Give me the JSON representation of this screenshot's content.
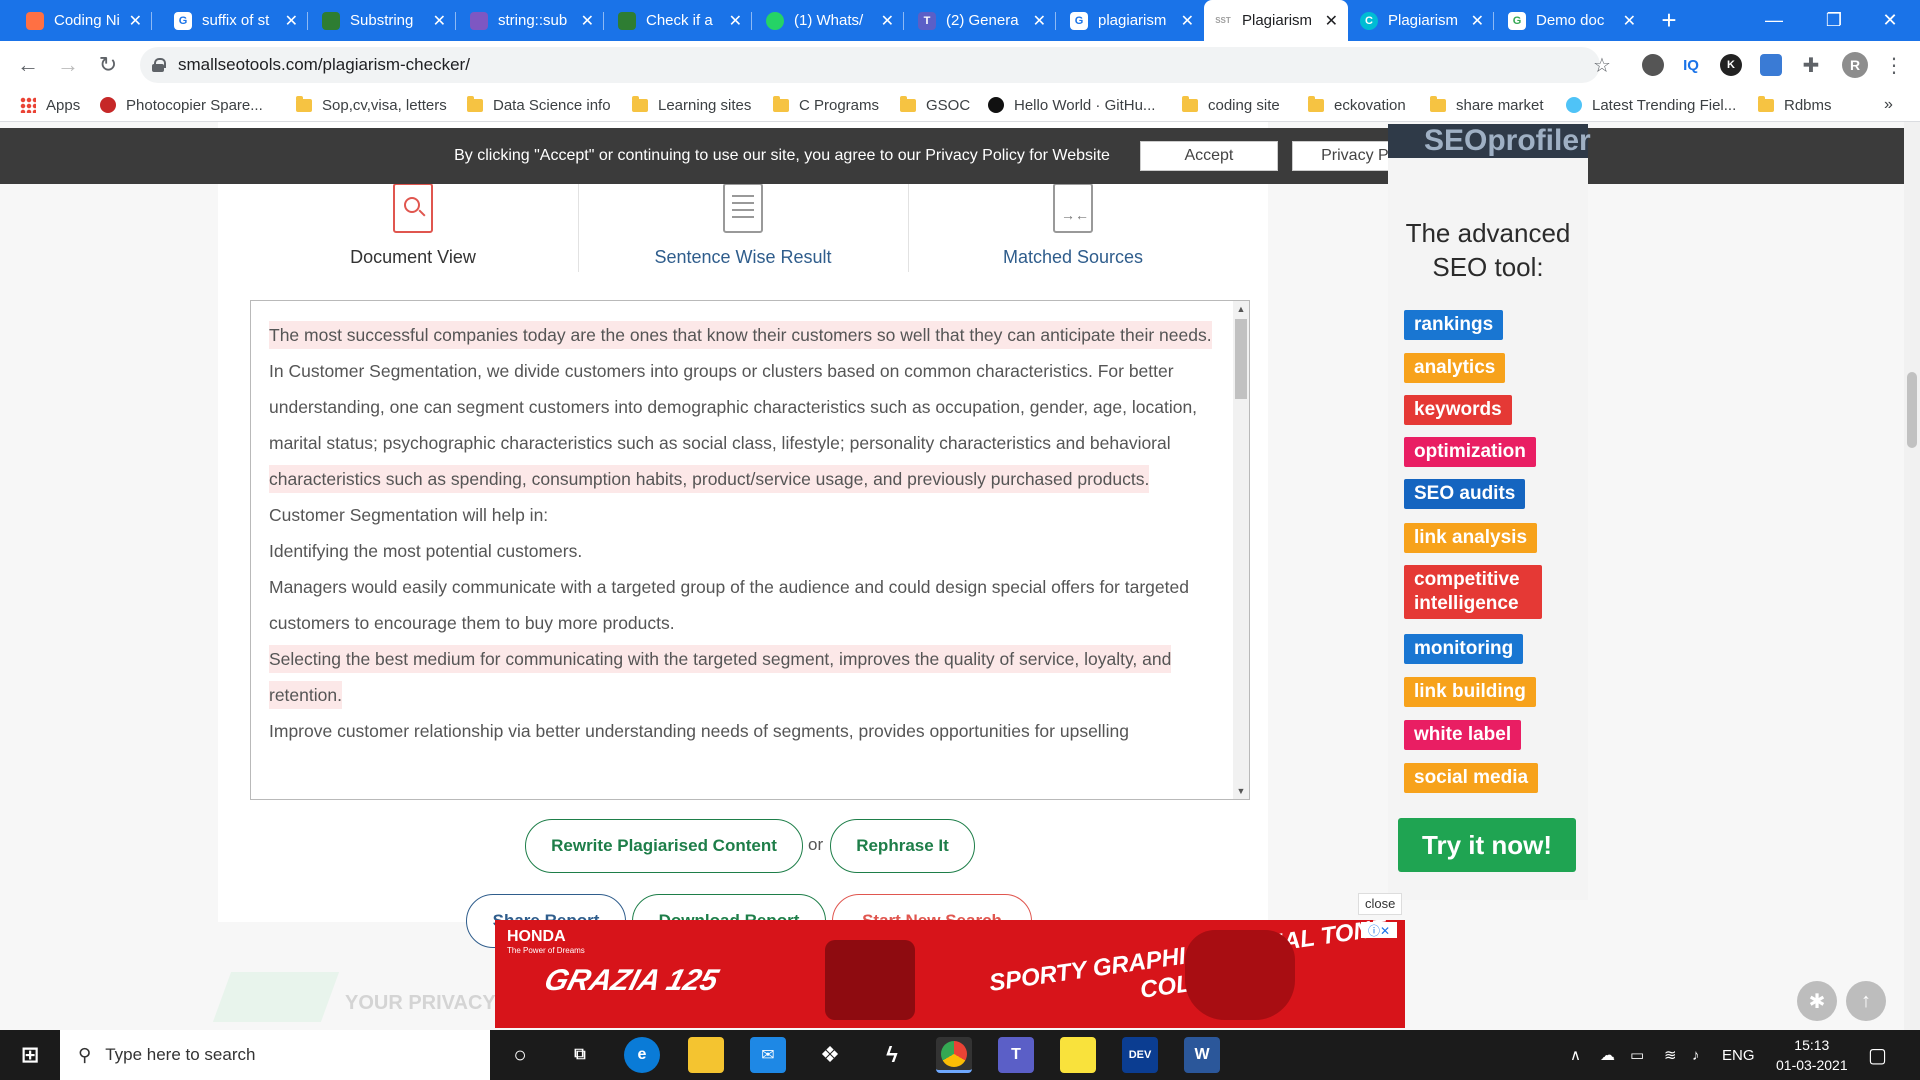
{
  "browser": {
    "tabs": [
      {
        "title": "Coding Ni",
        "color": "#ff7043",
        "active": false
      },
      {
        "title": "suffix of st",
        "color": "#ffffff",
        "active": false
      },
      {
        "title": "Substring",
        "color": "#2e7d32",
        "active": false
      },
      {
        "title": "string::sub",
        "color": "#7e57c2",
        "active": false
      },
      {
        "title": "Check if a",
        "color": "#2e7d32",
        "active": false
      },
      {
        "title": "(1) Whats/",
        "color": "#25d366",
        "active": false
      },
      {
        "title": "(2) Genera",
        "color": "#5b5fc7",
        "active": false
      },
      {
        "title": "plagiarism",
        "color": "#ffffff",
        "active": false
      },
      {
        "title": "Plagiarism",
        "color": "#9e9e9e",
        "active": true
      },
      {
        "title": "Plagiarism",
        "color": "#00bcd4",
        "active": false
      },
      {
        "title": "Demo doc",
        "color": "#34a853",
        "active": false
      }
    ],
    "new_tab": "+",
    "url": "smallseotools.com/plagiarism-checker/",
    "profile_initial": "R",
    "ext_iq": "IQ",
    "ext_k": "K"
  },
  "bookmarks": [
    {
      "label": "Apps",
      "kind": "apps"
    },
    {
      "label": "Photocopier Spare...",
      "kind": "site"
    },
    {
      "label": "Sop,cv,visa, letters",
      "kind": "folder"
    },
    {
      "label": "Data Science info",
      "kind": "folder"
    },
    {
      "label": "Learning sites",
      "kind": "folder"
    },
    {
      "label": "C Programs",
      "kind": "folder"
    },
    {
      "label": "GSOC",
      "kind": "folder"
    },
    {
      "label": "Hello World · GitHu...",
      "kind": "github"
    },
    {
      "label": "coding site",
      "kind": "folder"
    },
    {
      "label": "eckovation",
      "kind": "folder"
    },
    {
      "label": "share market",
      "kind": "folder"
    },
    {
      "label": "Latest Trending Fiel...",
      "kind": "site"
    },
    {
      "label": "Rdbms",
      "kind": "folder"
    }
  ],
  "cookie_bar": {
    "message": "By clicking \"Accept\" or continuing to use our site, you agree to our Privacy Policy for Website",
    "accept": "Accept",
    "privacy": "Privacy Policy"
  },
  "view_tabs": [
    {
      "label": "Document View",
      "color": "#333333"
    },
    {
      "label": "Sentence Wise Result",
      "color": "#2f5d8c"
    },
    {
      "label": "Matched Sources",
      "color": "#2f5d8c"
    }
  ],
  "document": {
    "p1_h1": "The most successful companies today are the ones that know their customers so well that they can anticipate their needs.",
    "p1_t1": " In Customer Segmentation, we divide customers into groups or clusters based on common characteristics. For better understanding, one can segment customers into demographic characteristics such as occupation, gender, age, location, marital status; psychographic characteristics such as social class, lifestyle; personality characteristics and behavioral ",
    "p1_h2": "characteristics such as spending, consumption habits, product/service usage, and previously purchased products.",
    "p2": "Customer Segmentation will help in:",
    "p3": "Identifying the most potential customers.",
    "p4": "Managers would easily communicate with a targeted group of the audience and could design special offers for targeted customers to encourage them to buy more products.",
    "p5_h": "Selecting the best medium for communicating with the targeted segment, improves the quality of service, loyalty, and retention.",
    "p6": "Improve customer relationship via better understanding needs of segments, provides opportunities for upselling"
  },
  "actions": {
    "rewrite": "Rewrite Plagiarised Content",
    "or": "or",
    "rephrase": "Rephrase It",
    "share": "Share Report",
    "download": "Download Report",
    "start_new": "Start New Search"
  },
  "privacy_teaser": "YOUR PRIVACY",
  "side_ad": {
    "brand": "SEOprofiler",
    "headline": "The advanced SEO tool:",
    "keywords": [
      {
        "label": "rankings",
        "color": "#1976d2"
      },
      {
        "label": "analytics",
        "color": "#f7a21b"
      },
      {
        "label": "keywords",
        "color": "#e53935"
      },
      {
        "label": "optimization",
        "color": "#e91e63"
      },
      {
        "label": "SEO audits",
        "color": "#1565c0"
      },
      {
        "label": "link analysis",
        "color": "#f7a21b"
      },
      {
        "label": "competitive intelligence",
        "color": "#e53935"
      },
      {
        "label": "monitoring",
        "color": "#1976d2"
      },
      {
        "label": "link building",
        "color": "#f7a21b"
      },
      {
        "label": "white label",
        "color": "#e91e63"
      },
      {
        "label": "social media",
        "color": "#f7a21b"
      }
    ],
    "cta": "Try it now!"
  },
  "bottom_ad": {
    "close": "close",
    "brand": "HONDA",
    "brand_sub": "The Power of Dreams",
    "model": "GRAZIA 125",
    "slogan": "SPORTY GRAPHICS & DUAL TONE COLOUR"
  },
  "taskbar": {
    "search_placeholder": "Type here to search",
    "lang": "ENG",
    "time": "15:13",
    "date": "01-03-2021",
    "dev_label": "DEV",
    "word_label": "W"
  }
}
